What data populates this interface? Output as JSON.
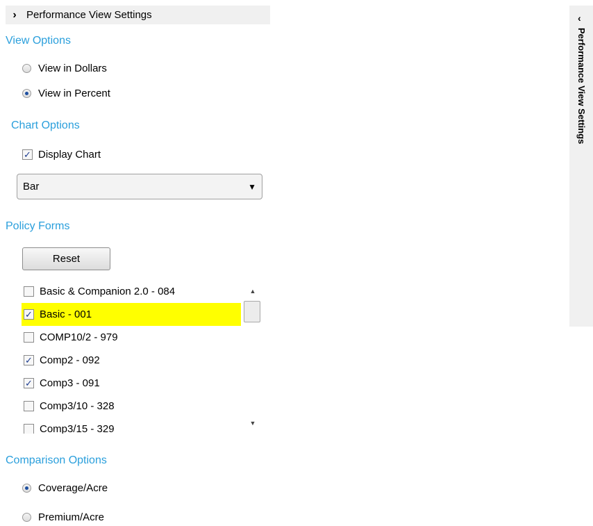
{
  "header": {
    "chevron": "›",
    "title": "Performance View Settings"
  },
  "view_options": {
    "title": "View Options",
    "options": [
      {
        "label": "View in Dollars",
        "checked": false
      },
      {
        "label": "View in Percent",
        "checked": true
      }
    ]
  },
  "chart_options": {
    "title": "Chart Options",
    "display_chart": {
      "label": "Display Chart",
      "checked": true
    },
    "chart_type": {
      "selected": "Bar"
    }
  },
  "policy_forms": {
    "title": "Policy Forms",
    "reset_label": "Reset",
    "items": [
      {
        "label": "Basic & Companion 2.0 - 084",
        "checked": false,
        "highlight": false
      },
      {
        "label": "Basic - 001",
        "checked": true,
        "highlight": true
      },
      {
        "label": "COMP10/2 - 979",
        "checked": false,
        "highlight": false
      },
      {
        "label": "Comp2 - 092",
        "checked": true,
        "highlight": false
      },
      {
        "label": "Comp3 - 091",
        "checked": true,
        "highlight": false
      },
      {
        "label": "Comp3/10 - 328",
        "checked": false,
        "highlight": false
      },
      {
        "label": "Comp3/15 - 329",
        "checked": false,
        "highlight": false
      }
    ]
  },
  "comparison_options": {
    "title": "Comparison Options",
    "options": [
      {
        "label": "Coverage/Acre",
        "checked": true
      },
      {
        "label": "Premium/Acre",
        "checked": false
      }
    ]
  },
  "side_tab": {
    "chevron": "‹",
    "title": "Performance View Settings"
  },
  "colors": {
    "section_title": "#2a9fdc",
    "highlight": "#ffff00",
    "header_bg": "#f0f0f0"
  }
}
